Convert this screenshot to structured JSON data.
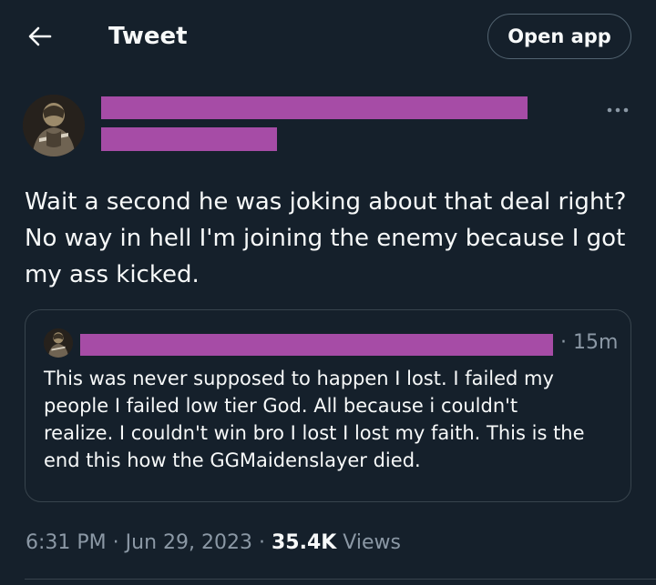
{
  "header": {
    "back_icon": "arrow-left-icon",
    "title": "Tweet",
    "open_app_label": "Open app"
  },
  "tweet": {
    "more_icon": "more-horizontal-icon",
    "text": "Wait a second he was joking about that deal right?\nNo way in hell I'm joining the enemy because I got\nmy ass kicked.",
    "redaction_color": "#a64ca6"
  },
  "quote": {
    "time": "· 15m",
    "text": "This was never supposed to happen I lost. I failed my\npeople I failed low tier God. All because i couldn't\nrealize. I couldn't win bro I lost I lost my faith. This is the\nend this how the GGMaidenslayer died."
  },
  "meta": {
    "time": "6:31 PM",
    "separator": " · ",
    "date": "Jun 29, 2023",
    "views_count": "35.4K",
    "views_label": " Views"
  },
  "colors": {
    "background": "#15202b",
    "text_primary": "#f7f9f9",
    "text_secondary": "#8b98a5",
    "border": "#38444d"
  }
}
